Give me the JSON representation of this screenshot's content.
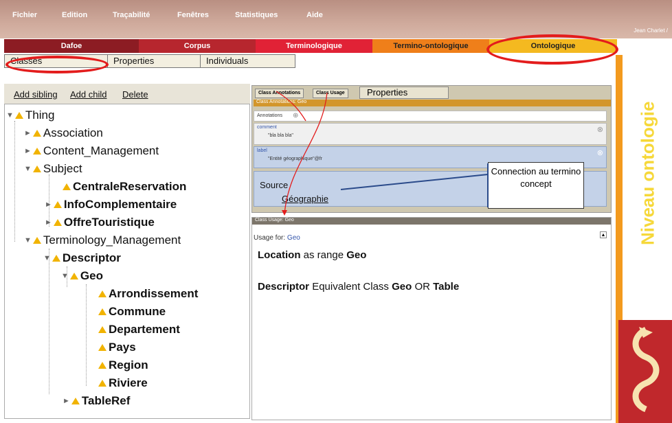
{
  "menu": {
    "items": [
      "Fichier",
      "Edition",
      "Traçabilité",
      "Fenêtres",
      "Statistiques",
      "Aide"
    ]
  },
  "user": "Jean Charlet /",
  "tabs": {
    "items": [
      "Dafoe",
      "Corpus",
      "Terminologique",
      "Termino-ontologique",
      "Ontologique"
    ]
  },
  "subtabs": {
    "items": [
      "Classes",
      "Properties",
      "Individuals"
    ]
  },
  "toolbar": {
    "add_sibling": "Add sibling",
    "add_child": "Add child",
    "delete": "Delete"
  },
  "tree": {
    "thing": "Thing",
    "association": "Association",
    "content": "Content_Management",
    "subject": "Subject",
    "centrale": "CentraleReservation",
    "info": "InfoComplementaire",
    "offre": "OffreTouristique",
    "terminology": "Terminology_Management",
    "descriptor": "Descriptor",
    "geo": "Geo",
    "arrondissement": "Arrondissement",
    "commune": "Commune",
    "departement": "Departement",
    "pays": "Pays",
    "region": "Region",
    "riviere": "Riviere",
    "tableref": "TableRef"
  },
  "annotations_panel": {
    "tab1": "Class Annotations",
    "tab2": "Class Usage",
    "tab3": "Properties",
    "header": "Class Annotations: Geo",
    "annotations_label": "Annotations",
    "comment_label": "comment",
    "comment_value": "\"bla bla bla\"",
    "label_label": "label",
    "label_value": "\"Entité géographique\"@fr",
    "source_label": "Source",
    "source_value": "Géographie"
  },
  "callout": {
    "text": "Connection au termino concept"
  },
  "usage_panel": {
    "header": "Class Usage: Geo",
    "usage_for_label": "Usage for:",
    "usage_for_value": "Geo",
    "line1_a": "Location",
    "line1_b": " as range ",
    "line1_c": "Geo",
    "line2_a": "Descriptor",
    "line2_b": " Equivalent Class ",
    "line2_c": "Geo",
    "line2_d": " OR ",
    "line2_e": "Table"
  },
  "side": {
    "text": "Niveau ontologie"
  },
  "colors": {
    "dafoe": "#8c1c23",
    "corpus": "#b7262e",
    "terminologique": "#e12236",
    "termino": "#ef7f1a",
    "ontologique": "#f4b920",
    "annotation_blue": "#c4d2e8",
    "orange": "#f39a1e",
    "red_annot": "#e31c1c"
  }
}
